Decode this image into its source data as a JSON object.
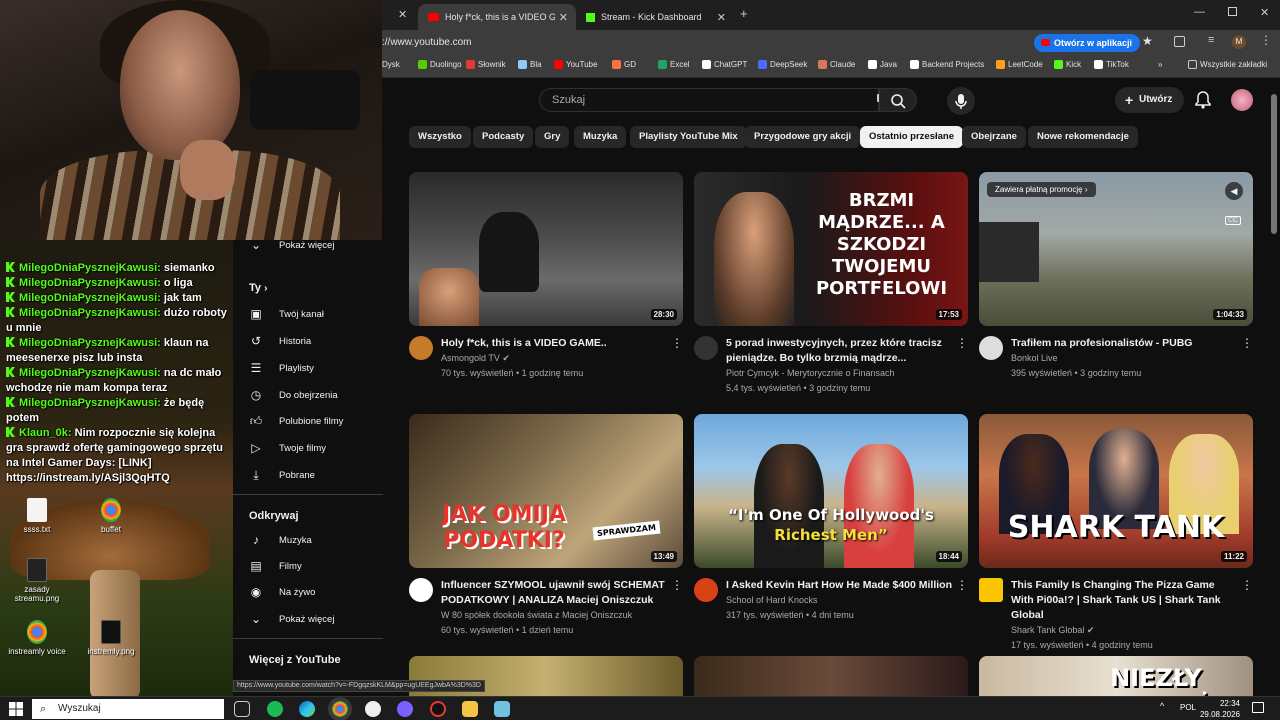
{
  "browser": {
    "tabs": [
      {
        "title": "Holy f*ck, this is a VIDEO GAME"
      },
      {
        "title": "Stream - Kick Dashboard"
      }
    ],
    "url": "://www.youtube.com",
    "open_in_app_label": "Otwórz w aplikacji",
    "all_bookmarks_label": "Wszystkie zakładki",
    "bookmarks": [
      {
        "label": "Dysk",
        "color": "#34a853"
      },
      {
        "label": "Duolingo",
        "color": "#58cc02"
      },
      {
        "label": "Słownik",
        "color": "#e53935"
      },
      {
        "label": "Bla",
        "color": "#90caf9"
      },
      {
        "label": "YouTube",
        "color": "#ff0000"
      },
      {
        "label": "GD",
        "color": "#ff7043"
      },
      {
        "label": "Excel",
        "color": "#21a366"
      },
      {
        "label": "ChatGPT",
        "color": "#ffffff"
      },
      {
        "label": "DeepSeek",
        "color": "#4d6bfe"
      },
      {
        "label": "Claude",
        "color": "#d97757"
      },
      {
        "label": "Java",
        "color": "#ffffff"
      },
      {
        "label": "Backend Projects",
        "color": "#ffffff"
      },
      {
        "label": "LeetCode",
        "color": "#ffa116"
      },
      {
        "label": "Kick",
        "color": "#53fc18"
      },
      {
        "label": "TikTok",
        "color": "#ffffff"
      }
    ],
    "status_url": "https://www.youtube.com/watch?v=-FDgqzskKLM&pp=ugUEEgJwbA%3D%3D"
  },
  "youtube": {
    "search_placeholder": "Szukaj",
    "create_label": "Utwórz",
    "chips": [
      "Wszystko",
      "Podcasty",
      "Gry",
      "Muzyka",
      "Playlisty YouTube Mix",
      "Przygodowe gry akcji",
      "Ostatnio przesłane",
      "Obejrzane",
      "Nowe rekomendacje"
    ],
    "active_chip": "Ostatnio przesłane",
    "sidebar": {
      "show_more_top": "Pokaż więcej",
      "you_section": "Ty",
      "you_items": [
        "Twój kanał",
        "Historia",
        "Playlisty",
        "Do obejrzenia",
        "Polubione filmy",
        "Twoje filmy",
        "Pobrane"
      ],
      "explore_section": "Odkrywaj",
      "explore_items": [
        "Muzyka",
        "Filmy",
        "Na żywo"
      ],
      "show_more_bottom": "Pokaż więcej",
      "more_section": "Więcej z YouTube"
    },
    "videos": [
      {
        "title": "Holy f*ck, this is a VIDEO GAME..",
        "channel": "Asmongold TV",
        "verified": true,
        "stats": "70 tys. wyświetleń • 1 godzinę temu",
        "duration": "28:30",
        "thumb_text": "",
        "avatar_color": "#c57b2a"
      },
      {
        "title": "5 porad inwestycyjnych, przez które tracisz pieniądze. Bo tylko brzmią mądrze...",
        "channel": "Piotr Cymcyk - Merytorycznie o Finansach",
        "verified": false,
        "stats": "5,4 tys. wyświetleń • 3 godziny temu",
        "duration": "17:53",
        "thumb_text": "BRZMI MĄDRZE... A SZKODZI TWOJEMU PORTFELOWI",
        "avatar_color": "#333333"
      },
      {
        "title": "Trafiłem na profesionalistów - PUBG",
        "channel": "Bonkol Live",
        "verified": false,
        "stats": "395 wyświetleń • 3 godziny temu",
        "duration": "1:04:33",
        "thumb_text": "Zawiera płatną promocję",
        "avatar_color": "#dddddd"
      },
      {
        "title": "Influencer SZYMOOL ujawnił swój SCHEMAT PODATKOWY | ANALIZA Maciej Oniszczuk",
        "channel": "W 80 spółek dookoła świata z Maciej Oniszczuk",
        "verified": false,
        "stats": "60 tys. wyświetleń • 1 dzień temu",
        "duration": "13:49",
        "thumb_text": "JAK OMIJA PODATKI?",
        "thumb_sub": "SPRAWDZAM",
        "avatar_color": "#ffffff"
      },
      {
        "title": "I Asked Kevin Hart How He Made $400 Million",
        "channel": "School of Hard Knocks",
        "verified": false,
        "stats": "317 tys. wyświetleń • 4 dni temu",
        "duration": "18:44",
        "thumb_text": "“I'm One Of Hollywood's",
        "thumb_sub": "Richest Men”",
        "avatar_color": "#d84315"
      },
      {
        "title": "This Family Is Changing The Pizza Game With Pi00a!? | Shark Tank US | Shark Tank Global",
        "channel": "Shark Tank Global",
        "verified": true,
        "stats": "17 tys. wyświetleń • 4 godziny temu",
        "duration": "11:22",
        "thumb_text": "SHARK TANK",
        "avatar_color": "#f9c400"
      }
    ],
    "partial_row_text": "NIEZŁY MONTAŻ"
  },
  "chat": [
    {
      "user": "MilegoDniaPysznejKawusi:",
      "msg": "siemanko"
    },
    {
      "user": "MilegoDniaPysznejKawusi:",
      "msg": "o liga"
    },
    {
      "user": "MilegoDniaPysznejKawusi:",
      "msg": "jak tam"
    },
    {
      "user": "MilegoDniaPysznejKawusi:",
      "msg": "dużo roboty u mnie"
    },
    {
      "user": "MilegoDniaPysznejKawusi:",
      "msg": "klaun na meesenerxe pisz lub insta"
    },
    {
      "user": "MilegoDniaPysznejKawusi:",
      "msg": "na dc mało wchodzę nie mam kompa teraz"
    },
    {
      "user": "MilegoDniaPysznejKawusi:",
      "msg": "że będę potem"
    },
    {
      "user": "Klaun_0k:",
      "msg": "Nim rozpocznie się kolejna gra sprawdź ofertę gamingowego sprzętu na Intel Gamer Days: [LINK] https://instream.ly/ASjl3QqHTQ"
    }
  ],
  "desktop_icons": [
    {
      "label": "ssss.txt"
    },
    {
      "label": "buffet"
    },
    {
      "label": "zasady streamu.png"
    },
    {
      "label": "instreamly voice"
    },
    {
      "label": "instremly.png"
    }
  ],
  "taskbar": {
    "search_placeholder": "Wyszukaj",
    "language": "POL",
    "time": "22:34",
    "date": "29.08.2026"
  }
}
